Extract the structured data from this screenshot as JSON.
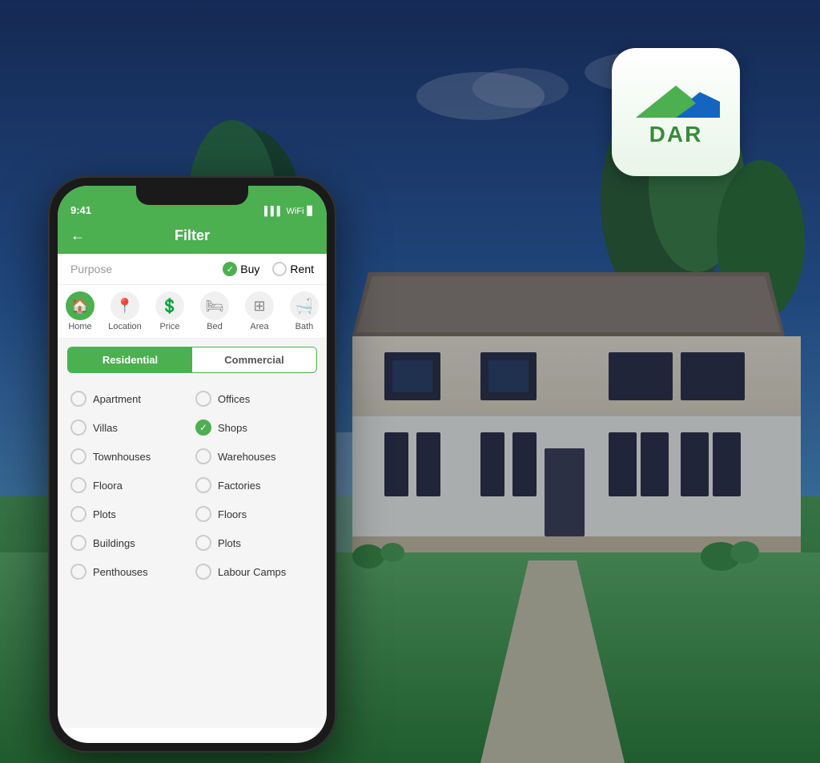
{
  "background": {
    "description": "House exterior with garden background"
  },
  "logo": {
    "text": "DAR",
    "ariaLabel": "DAR Real Estate Logo"
  },
  "phone": {
    "statusBar": {
      "time": "9:41",
      "signal": "▌▌▌",
      "wifi": "WiFi",
      "battery": "🔋"
    },
    "header": {
      "back": "←",
      "title": "Filter"
    },
    "purpose": {
      "label": "Purpose",
      "options": [
        {
          "label": "Buy",
          "checked": true
        },
        {
          "label": "Rent",
          "checked": false
        }
      ]
    },
    "navTabs": [
      {
        "label": "Home",
        "icon": "🏠",
        "active": true
      },
      {
        "label": "Location",
        "icon": "📍",
        "active": false
      },
      {
        "label": "Price",
        "icon": "💲",
        "active": false
      },
      {
        "label": "Bed",
        "icon": "🛏",
        "active": false
      },
      {
        "label": "Area",
        "icon": "⊞",
        "active": false
      },
      {
        "label": "Bath",
        "icon": "🛁",
        "active": false
      }
    ],
    "categoryTabs": [
      {
        "label": "Residential",
        "active": true
      },
      {
        "label": "Commercial",
        "active": false
      }
    ],
    "residentialItems": [
      {
        "label": "Apartment",
        "checked": false
      },
      {
        "label": "Offices",
        "checked": false
      },
      {
        "label": "Villas",
        "checked": false
      },
      {
        "label": "Shops",
        "checked": true
      },
      {
        "label": "Townhouses",
        "checked": false
      },
      {
        "label": "Warehouses",
        "checked": false
      },
      {
        "label": "Floora",
        "checked": false
      },
      {
        "label": "Factories",
        "checked": false
      },
      {
        "label": "Plots",
        "checked": false
      },
      {
        "label": "Floors",
        "checked": false
      },
      {
        "label": "Buildings",
        "checked": false
      },
      {
        "label": "Plots",
        "checked": false
      },
      {
        "label": "Penthouses",
        "checked": false
      },
      {
        "label": "Labour Camps",
        "checked": false
      }
    ]
  }
}
